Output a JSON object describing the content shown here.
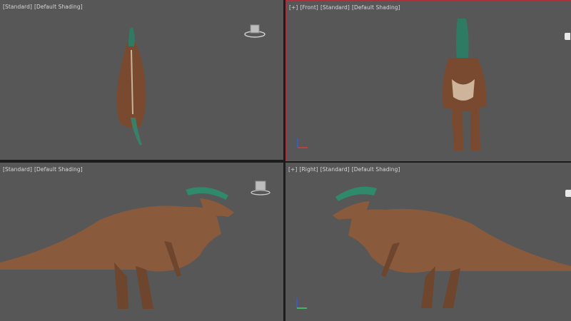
{
  "viewports": {
    "top_left": {
      "label_tags": [
        "[Standard]",
        "[Default Shading]"
      ]
    },
    "top_right": {
      "label_tags": [
        "[+]",
        "[Front]",
        "[Standard]",
        "[Default Shading]"
      ]
    },
    "bottom_left": {
      "label_tags": [
        "[Standard]",
        "[Default Shading]"
      ]
    },
    "bottom_right": {
      "label_tags": [
        "[+]",
        "[Right]",
        "[Standard]",
        "[Default Shading]"
      ]
    }
  },
  "colors": {
    "viewport_bg": "#575757",
    "active_border": "#b0303a",
    "frame": "#1c1c1c",
    "dino_body": "#8a5a3c",
    "dino_crest": "#2f8a6c"
  },
  "icons": {
    "viewcube": "viewcube-icon",
    "axis_gizmo": "axis-gizmo-icon",
    "model": "parasaurolophus-model"
  }
}
